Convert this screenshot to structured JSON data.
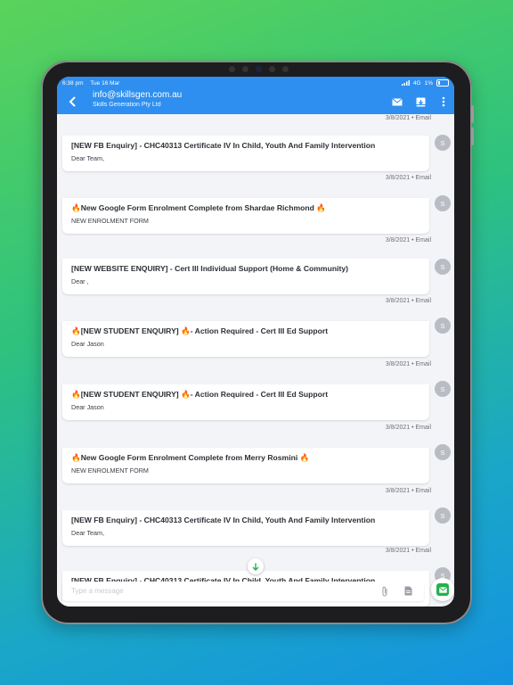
{
  "status_bar": {
    "time": "6:38 pm",
    "date": "Tue 16 Mar",
    "network": "4G",
    "battery": "1%"
  },
  "header": {
    "title": "info@skillsgen.com.au",
    "subtitle": "Skills Generation Pty Ltd"
  },
  "messages": [
    {
      "meta": "3/8/2021 • Email",
      "subject": "[NEW FB Enquiry] - CHC40313 Certificate IV In Child, Youth And Family Intervention",
      "preview": "Dear Team,",
      "avatar": "S"
    },
    {
      "meta": "3/8/2021 • Email",
      "subject": "🔥New Google Form Enrolment Complete from Shardae Richmond 🔥",
      "preview": "NEW ENROLMENT FORM",
      "avatar": "S"
    },
    {
      "meta": "3/8/2021 • Email",
      "subject": "[NEW WEBSITE ENQUIRY] - Cert III Individual Support (Home & Community)",
      "preview": "Dear ,",
      "avatar": "S"
    },
    {
      "meta": "3/8/2021 • Email",
      "subject": "🔥[NEW STUDENT ENQUIRY] 🔥- Action Required - Cert III Ed Support",
      "preview": "Dear Jason",
      "avatar": "S"
    },
    {
      "meta": "3/8/2021 • Email",
      "subject": "🔥[NEW STUDENT ENQUIRY] 🔥- Action Required - Cert III Ed Support",
      "preview": "Dear Jason",
      "avatar": "S"
    },
    {
      "meta": "3/8/2021 • Email",
      "subject": "🔥New Google Form Enrolment Complete from Merry Rosmini 🔥",
      "preview": "NEW ENROLMENT FORM",
      "avatar": "S"
    },
    {
      "meta": "3/8/2021 • Email",
      "subject": "[NEW FB Enquiry] - CHC40313 Certificate IV In Child, Youth And Family Intervention",
      "preview": "Dear Team,",
      "avatar": "S"
    },
    {
      "meta": "3/8/2021 • Email",
      "subject": "[NEW FB Enquiry] - CHC40313 Certificate IV In Child, Youth And Family Intervention",
      "preview": "",
      "avatar": "S"
    }
  ],
  "composer": {
    "placeholder": "Type a message"
  },
  "icons": {
    "back": "chevron-left-icon",
    "mail": "envelope-icon",
    "archive": "archive-icon",
    "more": "more-vertical-icon",
    "attach": "paperclip-icon",
    "template": "document-icon",
    "send": "send-email-icon",
    "scroll": "arrow-down-icon"
  },
  "colors": {
    "appbar": "#2e8ff0",
    "send": "#22b24c",
    "scroll_arrow": "#22b24c"
  }
}
